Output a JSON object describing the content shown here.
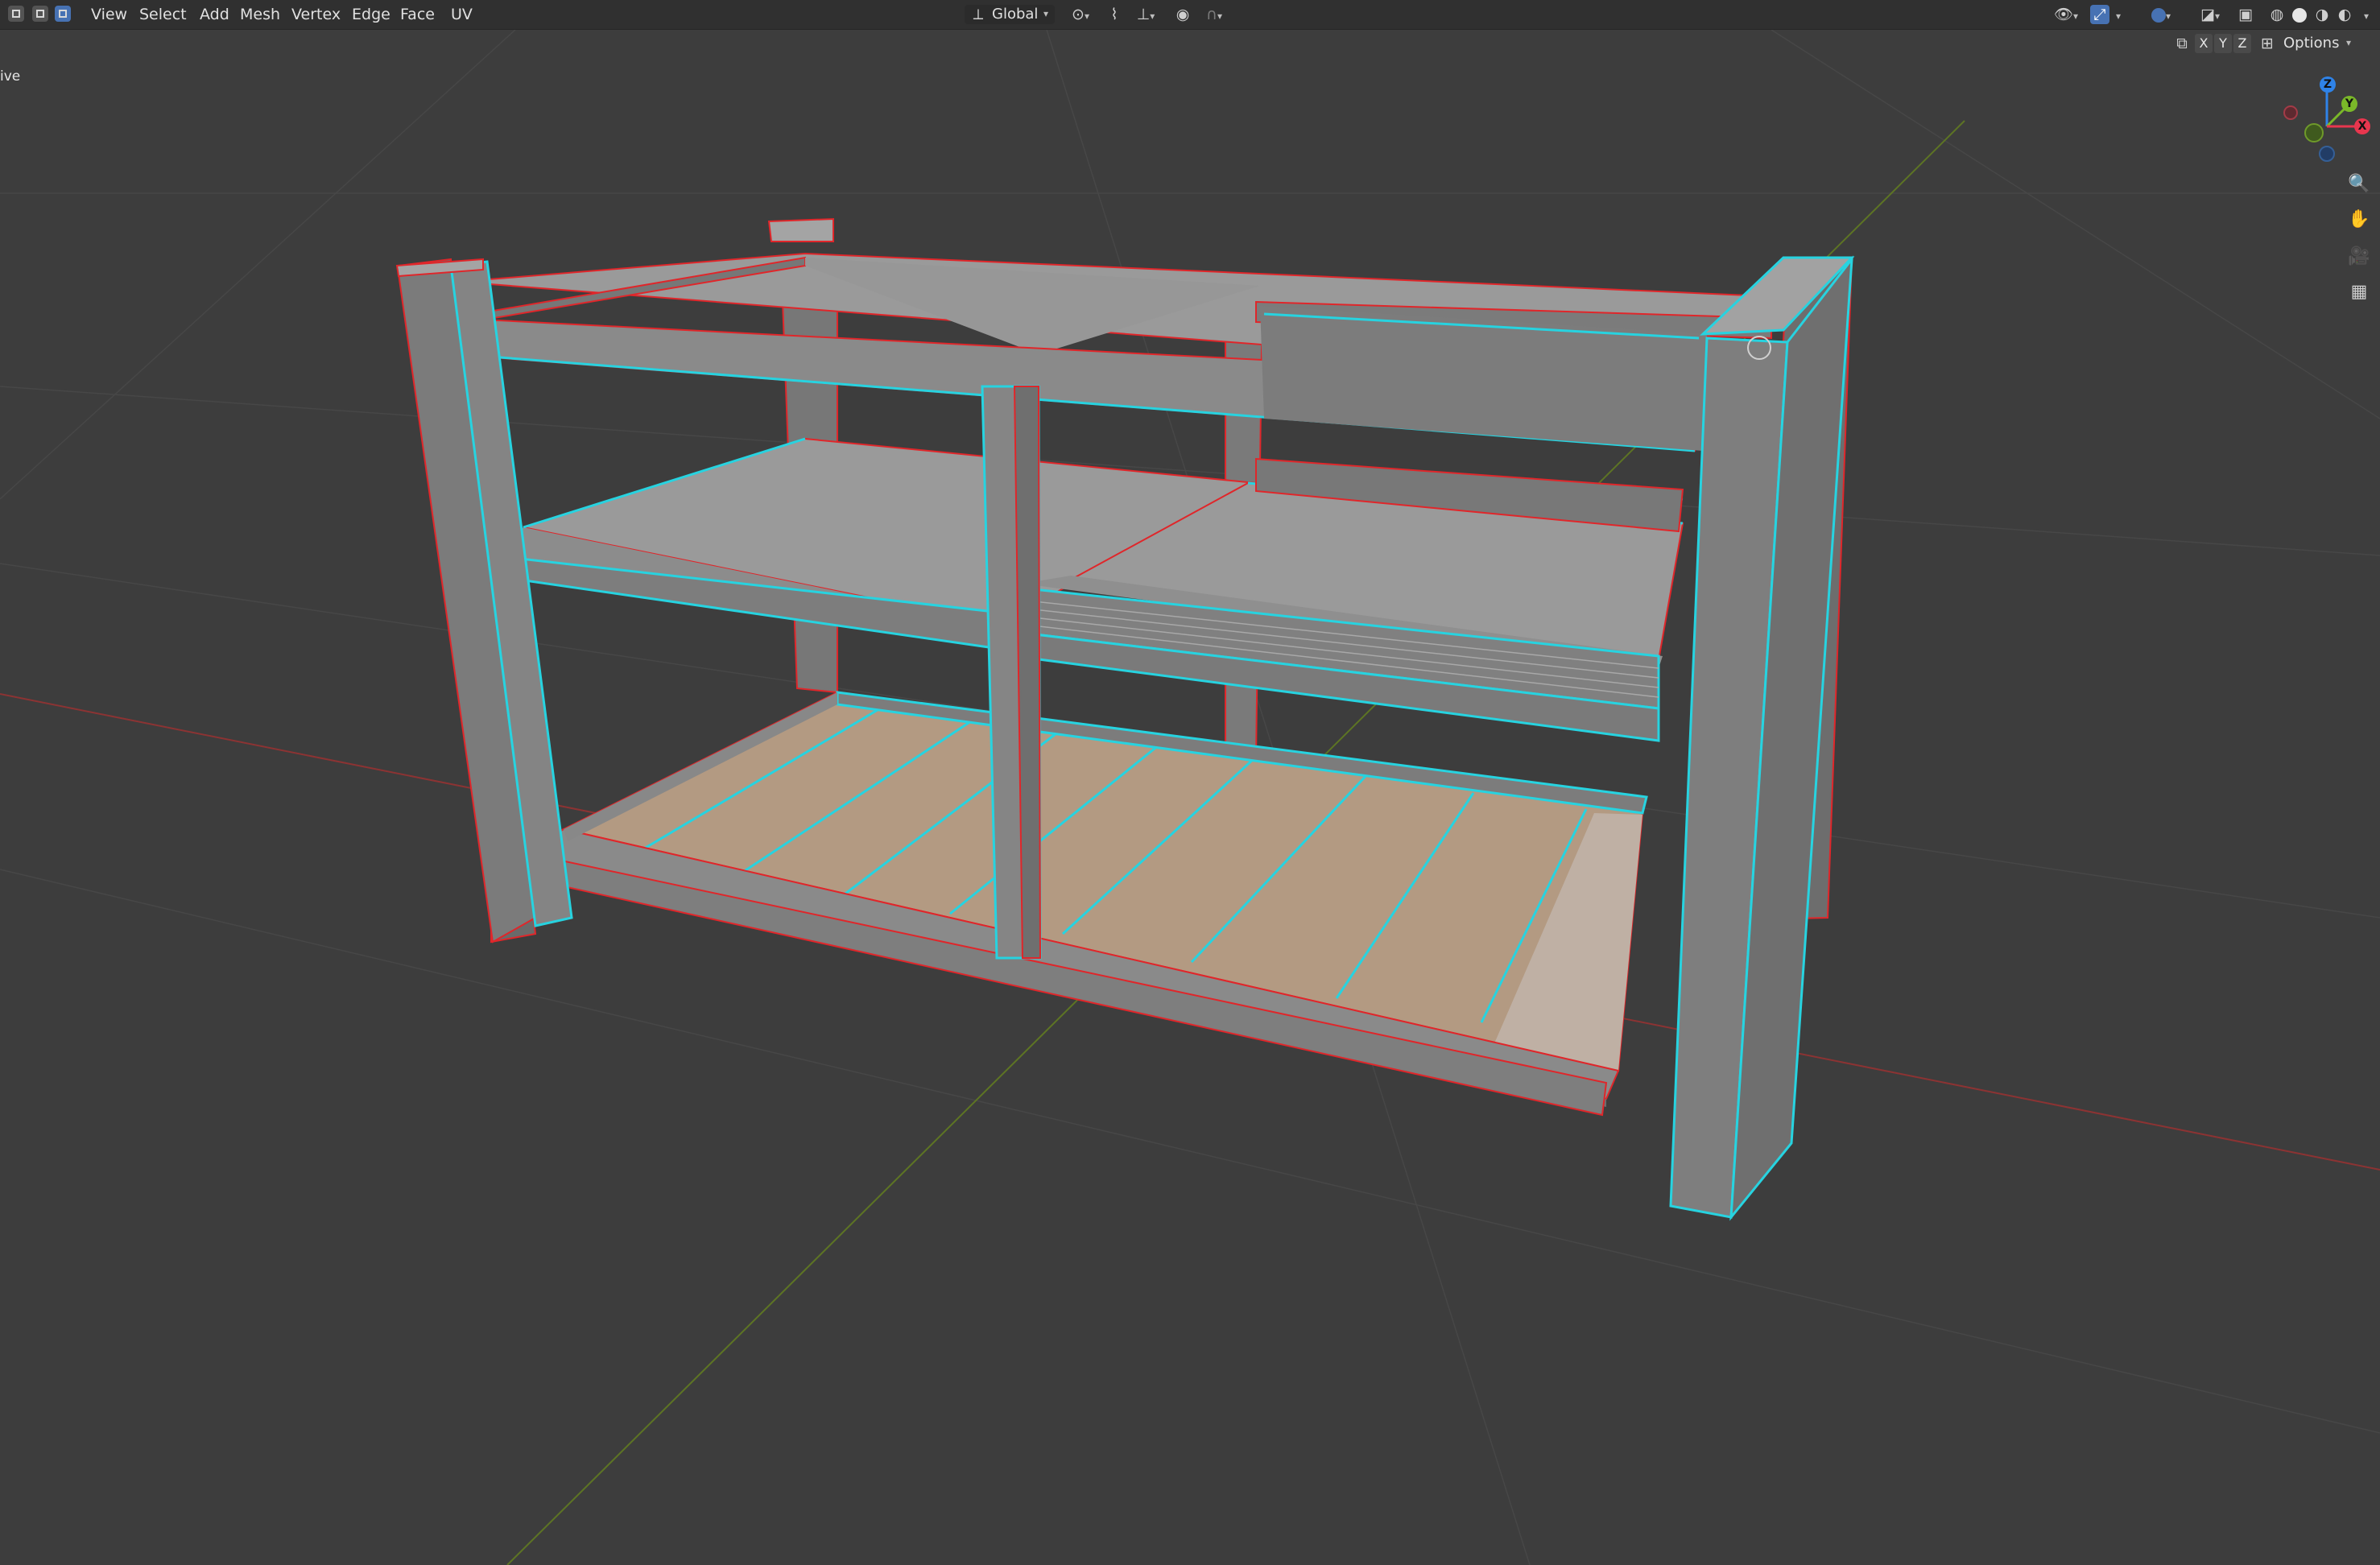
{
  "header": {
    "menus": [
      "View",
      "Select",
      "Add",
      "Mesh",
      "Vertex",
      "Edge",
      "Face",
      "UV"
    ],
    "transform_orientation": "Global"
  },
  "viewport": {
    "mode_label_partial": "ive",
    "options_label": "Options",
    "axis_buttons": [
      "X",
      "Y",
      "Z"
    ],
    "gizmo_axes": {
      "z": "Z",
      "y": "Y",
      "x": "X"
    },
    "colors": {
      "background": "#3d3d3d",
      "selected_edge": "#27d3e0",
      "unselected_edge": "#e0262a",
      "floor_x_axis": "#b03838",
      "floor_y_axis": "#6f8a2c",
      "wood": "#b39a82",
      "gray_face": "#8f8f8f"
    }
  }
}
